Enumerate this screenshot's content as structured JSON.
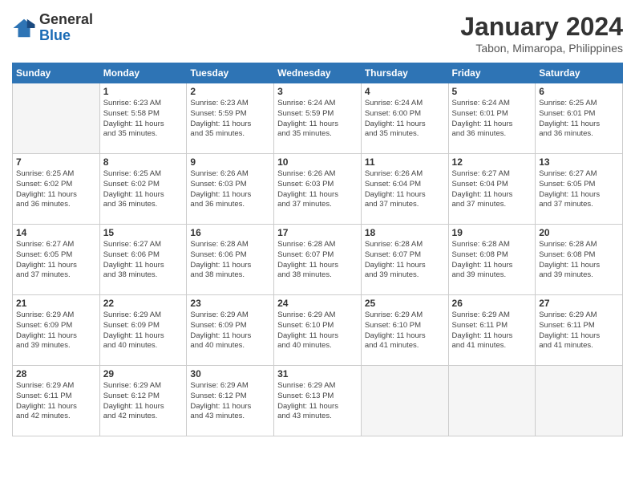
{
  "logo": {
    "general": "General",
    "blue": "Blue"
  },
  "title": "January 2024",
  "location": "Tabon, Mimaropa, Philippines",
  "days_header": [
    "Sunday",
    "Monday",
    "Tuesday",
    "Wednesday",
    "Thursday",
    "Friday",
    "Saturday"
  ],
  "weeks": [
    [
      {
        "num": "",
        "info": ""
      },
      {
        "num": "1",
        "info": "Sunrise: 6:23 AM\nSunset: 5:58 PM\nDaylight: 11 hours\nand 35 minutes."
      },
      {
        "num": "2",
        "info": "Sunrise: 6:23 AM\nSunset: 5:59 PM\nDaylight: 11 hours\nand 35 minutes."
      },
      {
        "num": "3",
        "info": "Sunrise: 6:24 AM\nSunset: 5:59 PM\nDaylight: 11 hours\nand 35 minutes."
      },
      {
        "num": "4",
        "info": "Sunrise: 6:24 AM\nSunset: 6:00 PM\nDaylight: 11 hours\nand 35 minutes."
      },
      {
        "num": "5",
        "info": "Sunrise: 6:24 AM\nSunset: 6:01 PM\nDaylight: 11 hours\nand 36 minutes."
      },
      {
        "num": "6",
        "info": "Sunrise: 6:25 AM\nSunset: 6:01 PM\nDaylight: 11 hours\nand 36 minutes."
      }
    ],
    [
      {
        "num": "7",
        "info": "Sunrise: 6:25 AM\nSunset: 6:02 PM\nDaylight: 11 hours\nand 36 minutes."
      },
      {
        "num": "8",
        "info": "Sunrise: 6:25 AM\nSunset: 6:02 PM\nDaylight: 11 hours\nand 36 minutes."
      },
      {
        "num": "9",
        "info": "Sunrise: 6:26 AM\nSunset: 6:03 PM\nDaylight: 11 hours\nand 36 minutes."
      },
      {
        "num": "10",
        "info": "Sunrise: 6:26 AM\nSunset: 6:03 PM\nDaylight: 11 hours\nand 37 minutes."
      },
      {
        "num": "11",
        "info": "Sunrise: 6:26 AM\nSunset: 6:04 PM\nDaylight: 11 hours\nand 37 minutes."
      },
      {
        "num": "12",
        "info": "Sunrise: 6:27 AM\nSunset: 6:04 PM\nDaylight: 11 hours\nand 37 minutes."
      },
      {
        "num": "13",
        "info": "Sunrise: 6:27 AM\nSunset: 6:05 PM\nDaylight: 11 hours\nand 37 minutes."
      }
    ],
    [
      {
        "num": "14",
        "info": "Sunrise: 6:27 AM\nSunset: 6:05 PM\nDaylight: 11 hours\nand 37 minutes."
      },
      {
        "num": "15",
        "info": "Sunrise: 6:27 AM\nSunset: 6:06 PM\nDaylight: 11 hours\nand 38 minutes."
      },
      {
        "num": "16",
        "info": "Sunrise: 6:28 AM\nSunset: 6:06 PM\nDaylight: 11 hours\nand 38 minutes."
      },
      {
        "num": "17",
        "info": "Sunrise: 6:28 AM\nSunset: 6:07 PM\nDaylight: 11 hours\nand 38 minutes."
      },
      {
        "num": "18",
        "info": "Sunrise: 6:28 AM\nSunset: 6:07 PM\nDaylight: 11 hours\nand 39 minutes."
      },
      {
        "num": "19",
        "info": "Sunrise: 6:28 AM\nSunset: 6:08 PM\nDaylight: 11 hours\nand 39 minutes."
      },
      {
        "num": "20",
        "info": "Sunrise: 6:28 AM\nSunset: 6:08 PM\nDaylight: 11 hours\nand 39 minutes."
      }
    ],
    [
      {
        "num": "21",
        "info": "Sunrise: 6:29 AM\nSunset: 6:09 PM\nDaylight: 11 hours\nand 39 minutes."
      },
      {
        "num": "22",
        "info": "Sunrise: 6:29 AM\nSunset: 6:09 PM\nDaylight: 11 hours\nand 40 minutes."
      },
      {
        "num": "23",
        "info": "Sunrise: 6:29 AM\nSunset: 6:09 PM\nDaylight: 11 hours\nand 40 minutes."
      },
      {
        "num": "24",
        "info": "Sunrise: 6:29 AM\nSunset: 6:10 PM\nDaylight: 11 hours\nand 40 minutes."
      },
      {
        "num": "25",
        "info": "Sunrise: 6:29 AM\nSunset: 6:10 PM\nDaylight: 11 hours\nand 41 minutes."
      },
      {
        "num": "26",
        "info": "Sunrise: 6:29 AM\nSunset: 6:11 PM\nDaylight: 11 hours\nand 41 minutes."
      },
      {
        "num": "27",
        "info": "Sunrise: 6:29 AM\nSunset: 6:11 PM\nDaylight: 11 hours\nand 41 minutes."
      }
    ],
    [
      {
        "num": "28",
        "info": "Sunrise: 6:29 AM\nSunset: 6:11 PM\nDaylight: 11 hours\nand 42 minutes."
      },
      {
        "num": "29",
        "info": "Sunrise: 6:29 AM\nSunset: 6:12 PM\nDaylight: 11 hours\nand 42 minutes."
      },
      {
        "num": "30",
        "info": "Sunrise: 6:29 AM\nSunset: 6:12 PM\nDaylight: 11 hours\nand 43 minutes."
      },
      {
        "num": "31",
        "info": "Sunrise: 6:29 AM\nSunset: 6:13 PM\nDaylight: 11 hours\nand 43 minutes."
      },
      {
        "num": "",
        "info": ""
      },
      {
        "num": "",
        "info": ""
      },
      {
        "num": "",
        "info": ""
      }
    ]
  ]
}
